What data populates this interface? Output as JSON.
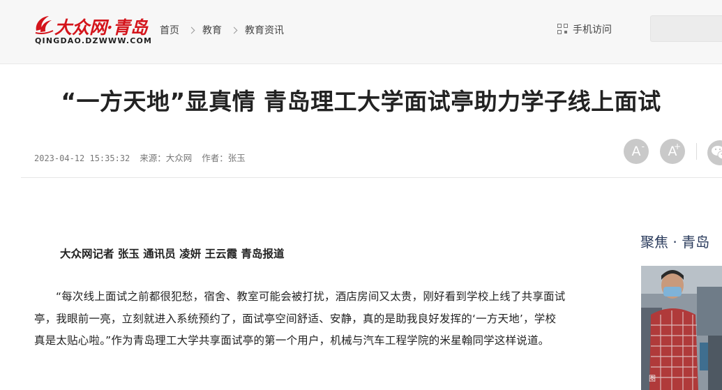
{
  "header": {
    "logo_cn": "大众网·青岛",
    "logo_en": "QINGDAO.DZWWW.COM",
    "breadcrumb": [
      "首页",
      "教育",
      "教育资讯"
    ],
    "mobile_access": "手机访问",
    "search_placeholder": ""
  },
  "article": {
    "title": "“一方天地”显真情 青岛理工大学面试亭助力学子线上面试",
    "datetime": "2023-04-12 15:35:32",
    "source": "来源：大众网",
    "author": "作者：张玉",
    "byline": "大众网记者 张玉 通讯员 凌妍 王云霞 青岛报道",
    "paragraph": "“每次线上面试之前都很犯愁，宿舍、教室可能会被打扰，酒店房间又太贵，刚好看到学校上线了共享面试亭，我眼前一亮，立刻就进入系统预约了，面试亭空间舒适、安静，真的是助我良好发挥的‘一方天地’，学校真是太贴心啦。”作为青岛理工大学共享面试亭的第一个用户，机械与汽车工程学院的米星翰同学这样说道。"
  },
  "tools": {
    "font_smaller": "A",
    "font_smaller_mark": "-",
    "font_larger": "A",
    "font_larger_mark": "+",
    "share_icon": "wechat-icon"
  },
  "sidebar": {
    "title": "聚焦 · 青岛",
    "photo_caption": "图"
  },
  "colors": {
    "brand_red": "#d4141b",
    "sidebar_title": "#2a3b5c",
    "tool_gray": "#c9c9c9"
  }
}
